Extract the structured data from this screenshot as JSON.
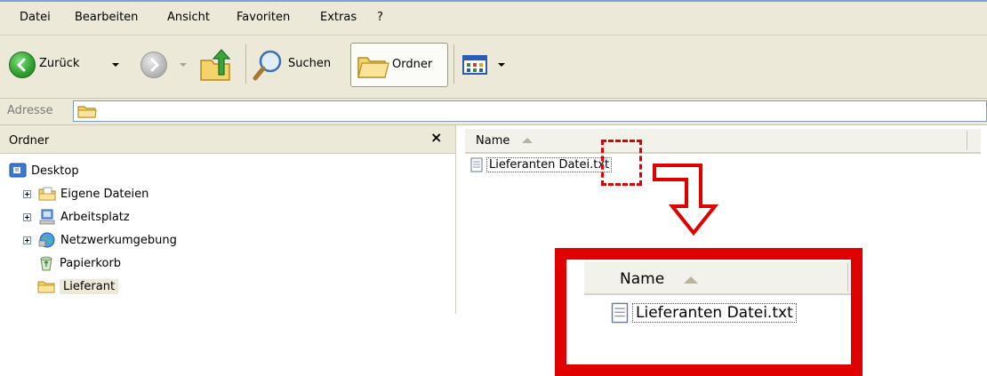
{
  "menu": {
    "items": [
      {
        "label": "Datei"
      },
      {
        "label": "Bearbeiten"
      },
      {
        "label": "Ansicht"
      },
      {
        "label": "Favoriten"
      },
      {
        "label": "Extras"
      },
      {
        "label": "?"
      }
    ]
  },
  "toolbar": {
    "back_label": "Zurück",
    "search_label": "Suchen",
    "folders_label": "Ordner"
  },
  "address": {
    "label": "Adresse",
    "value": ""
  },
  "folder_pane": {
    "title": "Ordner",
    "close_glyph": "×",
    "items": [
      {
        "label": "Desktop",
        "icon": "desktop-icon"
      },
      {
        "label": "Eigene Dateien",
        "icon": "my-documents-icon"
      },
      {
        "label": "Arbeitsplatz",
        "icon": "my-computer-icon"
      },
      {
        "label": "Netzwerkumgebung",
        "icon": "network-icon"
      },
      {
        "label": "Papierkorb",
        "icon": "recycle-bin-icon"
      },
      {
        "label": "Lieferant",
        "icon": "folder-icon",
        "selected": true
      }
    ]
  },
  "file_pane": {
    "column_name": "Name",
    "files": [
      {
        "name": "Lieferanten Datei.txt",
        "icon": "text-file-icon"
      }
    ]
  },
  "callout": {
    "column_name": "Name",
    "file_name": "Lieferanten Datei.txt",
    "colors": {
      "highlight": "#e00000"
    }
  },
  "colors": {
    "chrome": "#ece9d8",
    "address_border": "#7f9db9",
    "highlight": "#e00000"
  }
}
